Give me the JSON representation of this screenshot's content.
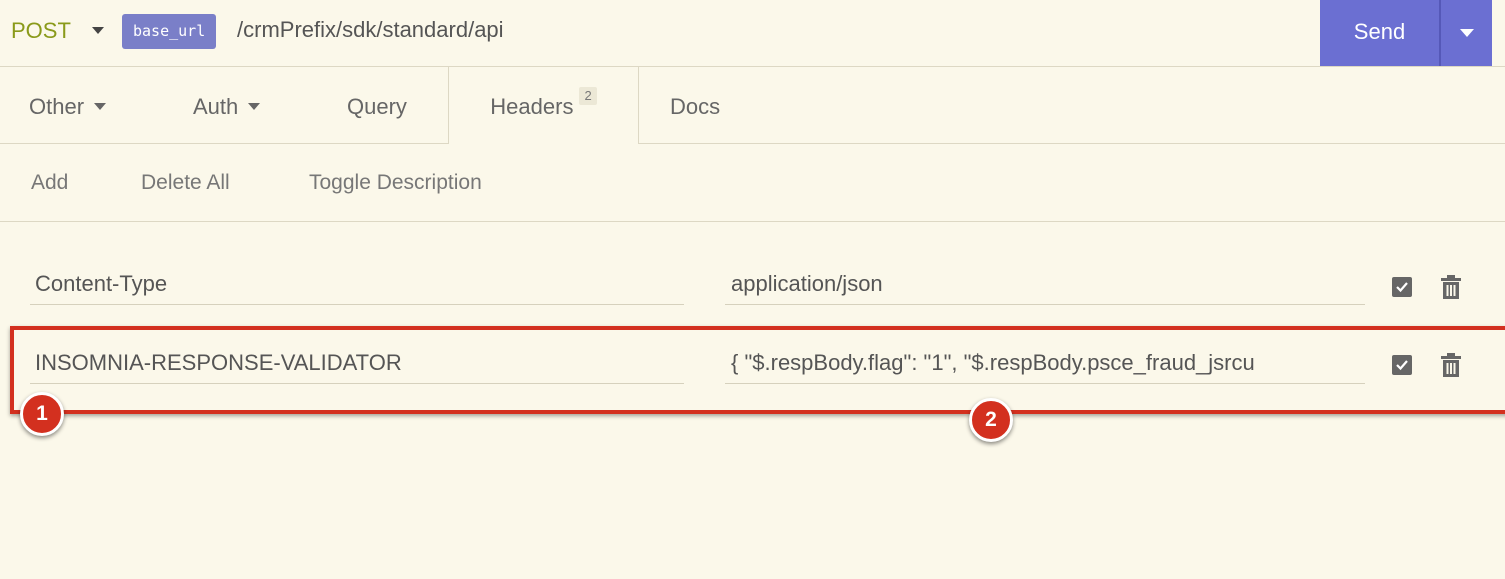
{
  "request": {
    "method": "POST",
    "url_variable": "base_url",
    "url_path": "/crmPrefix/sdk/standard/api",
    "send_label": "Send"
  },
  "tabs": [
    {
      "label": "Other"
    },
    {
      "label": "Auth"
    },
    {
      "label": "Query"
    },
    {
      "label": "Headers",
      "badge": "2"
    },
    {
      "label": "Docs"
    }
  ],
  "actions": {
    "add": "Add",
    "delete_all": "Delete All",
    "toggle_description": "Toggle Description"
  },
  "headers": [
    {
      "name": "Content-Type",
      "value": "application/json",
      "enabled": true
    },
    {
      "name": "INSOMNIA-RESPONSE-VALIDATOR",
      "value": "{    \"$.respBody.flag\": \"1\",    \"$.respBody.psce_fraud_jsrcu",
      "enabled": true
    }
  ],
  "annotations": {
    "marker_1": "1",
    "marker_2": "2"
  },
  "colors": {
    "background": "#fbf8ea",
    "accent": "#6b6fd2",
    "method": "#8a9a1a",
    "highlight": "#d3301f"
  }
}
